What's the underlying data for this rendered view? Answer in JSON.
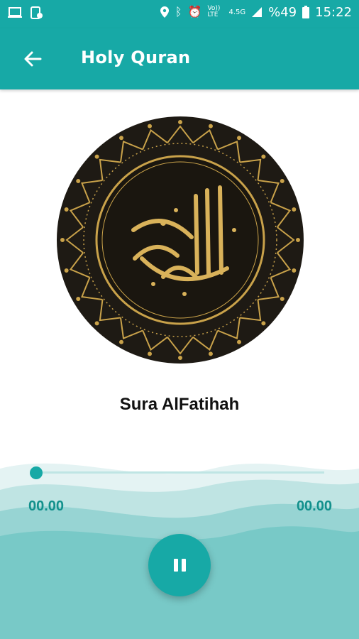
{
  "status_bar": {
    "left_icons": [
      "laptop-icon",
      "phone-screen-icon"
    ],
    "right_icons": [
      "location-icon",
      "bluetooth-icon",
      "alarm-icon",
      "volte-icon",
      "mobile-data-icon",
      "signal-icon"
    ],
    "volte": "Vo)) LTE",
    "network": "4.5G",
    "battery": "%49",
    "time": "15:22"
  },
  "app_bar": {
    "title": "Holy Quran",
    "back_icon": "arrow-left-icon"
  },
  "player": {
    "track_title": "Sura AlFatihah",
    "elapsed": "00.00",
    "duration": "00.00",
    "progress": 0,
    "play_state_icon": "pause-icon"
  },
  "colors": {
    "primary": "#17a9a6",
    "wave_light": "#d6eeee",
    "wave_mid": "#9fd8d7",
    "wave_deep": "#5fc3c1",
    "emblem_bg": "#1e1a14",
    "emblem_gold": "#c9a24a"
  }
}
